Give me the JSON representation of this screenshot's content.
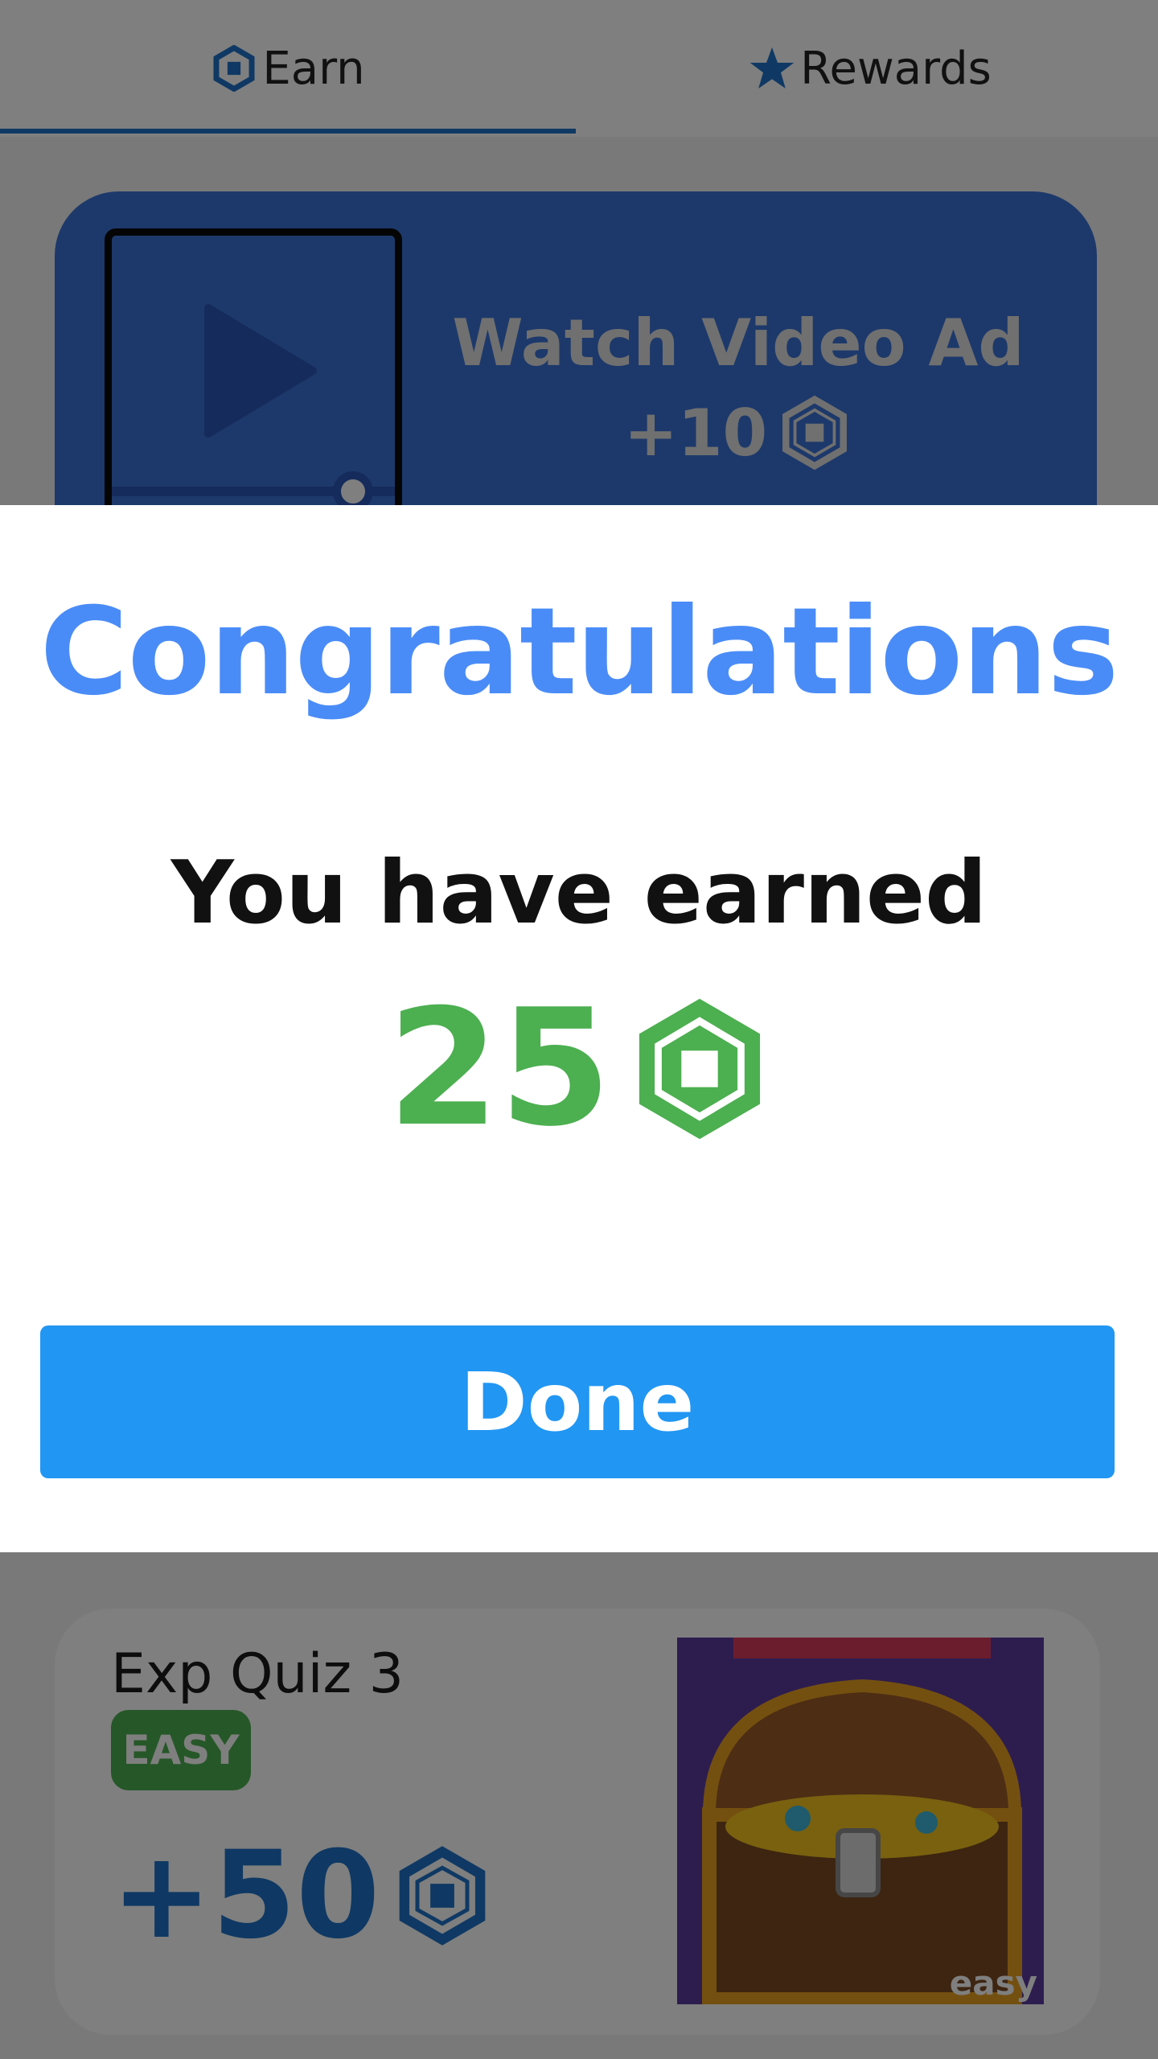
{
  "tabs": {
    "earn_label": "Earn",
    "rewards_label": "Rewards",
    "active": "earn"
  },
  "video_card": {
    "title": "Watch Video Ad",
    "reward": "+10"
  },
  "quiz_card": {
    "title": "Exp Quiz 3",
    "difficulty": "EASY",
    "reward": "+50",
    "image_badge": "easy"
  },
  "dialog": {
    "title": "Congratulations",
    "message": "You have earned",
    "amount": "25",
    "done_label": "Done"
  },
  "icons": {
    "currency": "robux-hexagon-icon",
    "star": "star-icon",
    "play": "play-icon"
  },
  "colors": {
    "primary_blue": "#2196f3",
    "title_blue": "#4a8cf7",
    "card_blue": "#3b73d6",
    "tab_blue": "#1e73c8",
    "success_green": "#4caf50"
  }
}
